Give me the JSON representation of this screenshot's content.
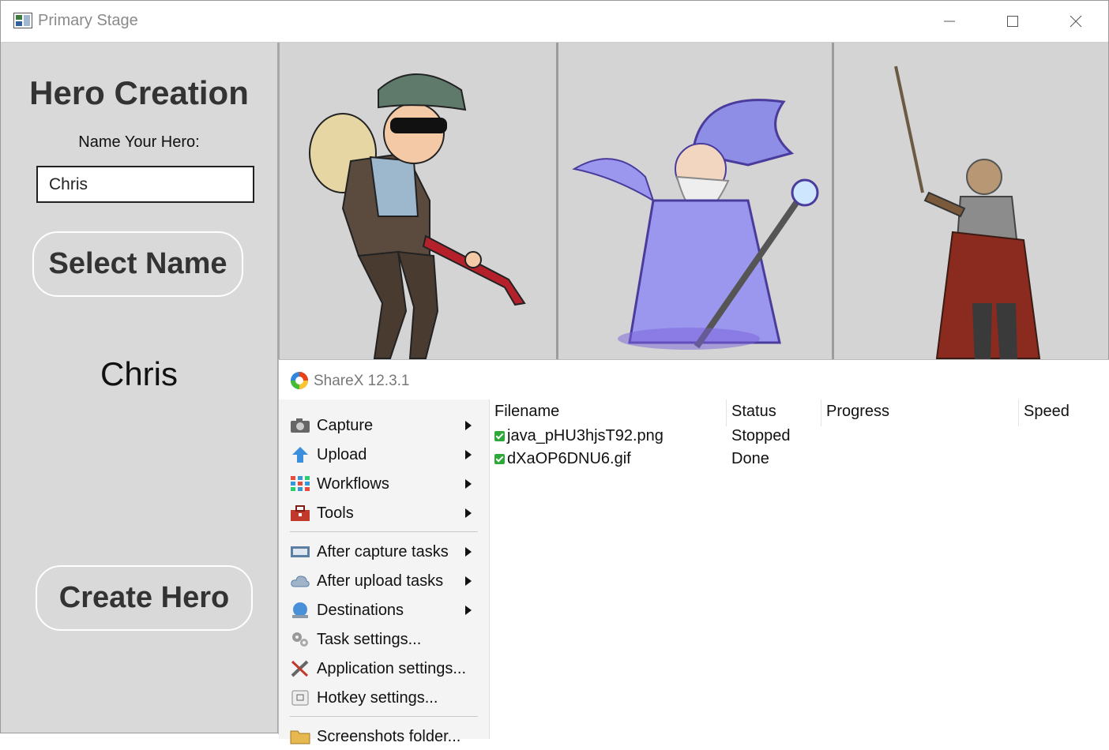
{
  "primary_window": {
    "title": "Primary Stage",
    "controls": [
      "minimize",
      "maximize",
      "close"
    ]
  },
  "hero_panel": {
    "heading": "Hero Creation",
    "name_label": "Name Your Hero:",
    "name_value": "Chris",
    "select_button": "Select Name",
    "selected_name": "Chris",
    "create_button": "Create Hero"
  },
  "gallery": {
    "characters": [
      "thief",
      "wizard",
      "knight"
    ]
  },
  "sharex": {
    "title": "ShareX 12.3.1",
    "menu": [
      {
        "label": "Capture",
        "icon": "camera-icon",
        "submenu": true
      },
      {
        "label": "Upload",
        "icon": "upload-arrow-icon",
        "submenu": true
      },
      {
        "label": "Workflows",
        "icon": "workflow-grid-icon",
        "submenu": true
      },
      {
        "label": "Tools",
        "icon": "toolbox-icon",
        "submenu": true
      },
      {
        "label": "After capture tasks",
        "icon": "after-capture-icon",
        "submenu": true
      },
      {
        "label": "After upload tasks",
        "icon": "cloud-upload-icon",
        "submenu": true
      },
      {
        "label": "Destinations",
        "icon": "globe-icon",
        "submenu": true
      },
      {
        "label": "Task settings...",
        "icon": "gears-icon",
        "submenu": false
      },
      {
        "label": "Application settings...",
        "icon": "wrench-icon",
        "submenu": false
      },
      {
        "label": "Hotkey settings...",
        "icon": "keyboard-key-icon",
        "submenu": false
      },
      {
        "label": "Screenshots folder...",
        "icon": "folder-icon",
        "submenu": false
      }
    ],
    "columns": {
      "filename": "Filename",
      "status": "Status",
      "progress": "Progress",
      "speed": "Speed"
    },
    "tasks": [
      {
        "filename": "java_pHU3hjsT92.png",
        "status": "Stopped"
      },
      {
        "filename": "dXaOP6DNU6.gif",
        "status": "Done"
      }
    ]
  }
}
